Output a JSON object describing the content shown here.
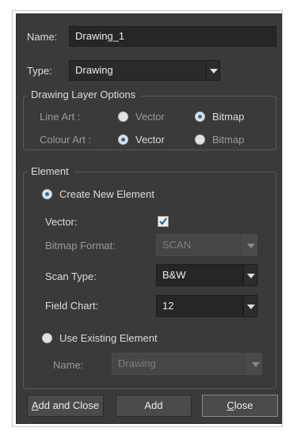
{
  "dialog": {
    "name_label": "Name:",
    "name_value": "Drawing_1",
    "type_label": "Type:",
    "type_value": "Drawing"
  },
  "layer_options": {
    "title": "Drawing Layer Options",
    "line_art_label": "Line Art :",
    "colour_art_label": "Colour Art :",
    "vector_label": "Vector",
    "bitmap_label": "Bitmap",
    "line_art_selected": "Bitmap",
    "colour_art_selected": "Vector"
  },
  "element": {
    "title": "Element",
    "create_new_label": "Create New Element",
    "create_new_selected": true,
    "vector_label": "Vector:",
    "vector_checked": true,
    "bitmap_format_label": "Bitmap Format:",
    "bitmap_format_value": "SCAN",
    "scan_type_label": "Scan Type:",
    "scan_type_value": "B&W",
    "field_chart_label": "Field Chart:",
    "field_chart_value": "12",
    "use_existing_label": "Use Existing Element",
    "use_existing_selected": false,
    "existing_name_label": "Name:",
    "existing_name_value": "Drawing"
  },
  "buttons": {
    "add_and_close_mnemonic": "A",
    "add_and_close_rest": "dd and Close",
    "add_label": "Add",
    "close_mnemonic": "C",
    "close_rest": "lose"
  },
  "colors": {
    "background": "#3a3a3a",
    "field": "#262626",
    "radio_dot": "#1f6fb5"
  }
}
